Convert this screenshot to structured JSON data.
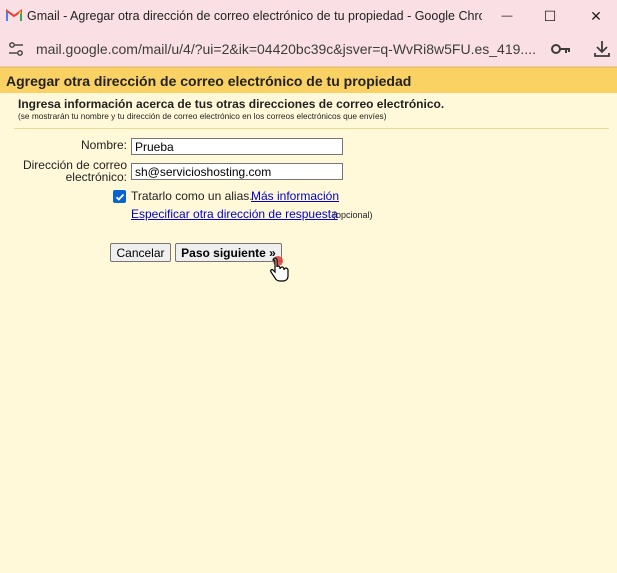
{
  "window": {
    "title": "Gmail - Agregar otra dirección de correo electrónico de tu propiedad - Google Chro...",
    "minimize_glyph": "—",
    "maximize_glyph": "☐",
    "close_glyph": "✕"
  },
  "addressbar": {
    "url": "mail.google.com/mail/u/4/?ui=2&ik=04420bc39c&jsver=q-WvRi8w5FU.es_419...."
  },
  "header": {
    "title": "Agregar otra dirección de correo electrónico de tu propiedad"
  },
  "section": {
    "title": "Ingresa información acerca de tus otras direcciones de correo electrónico.",
    "subtitle": "(se mostrarán tu nombre y tu dirección de correo electrónico en los correos electrónicos que envíes)"
  },
  "form": {
    "name_label": "Nombre:",
    "name_value": "Prueba",
    "email_label_line1": "Dirección de correo",
    "email_label_line2": "electrónico:",
    "email_value": "sh@servicioshosting.com",
    "alias_checked": true,
    "alias_label": "Tratarlo como un alias.",
    "more_info_link": "Más información",
    "reply_to_link": "Especificar otra dirección de respuesta",
    "optional_note": "(opcional)"
  },
  "buttons": {
    "cancel": "Cancelar",
    "next": "Paso siguiente »"
  },
  "colors": {
    "header_band": "#fad163",
    "page_background": "#fff9da",
    "titlebar": "#fae0e4",
    "link": "#0000cc",
    "checkbox": "#0b63ce"
  }
}
